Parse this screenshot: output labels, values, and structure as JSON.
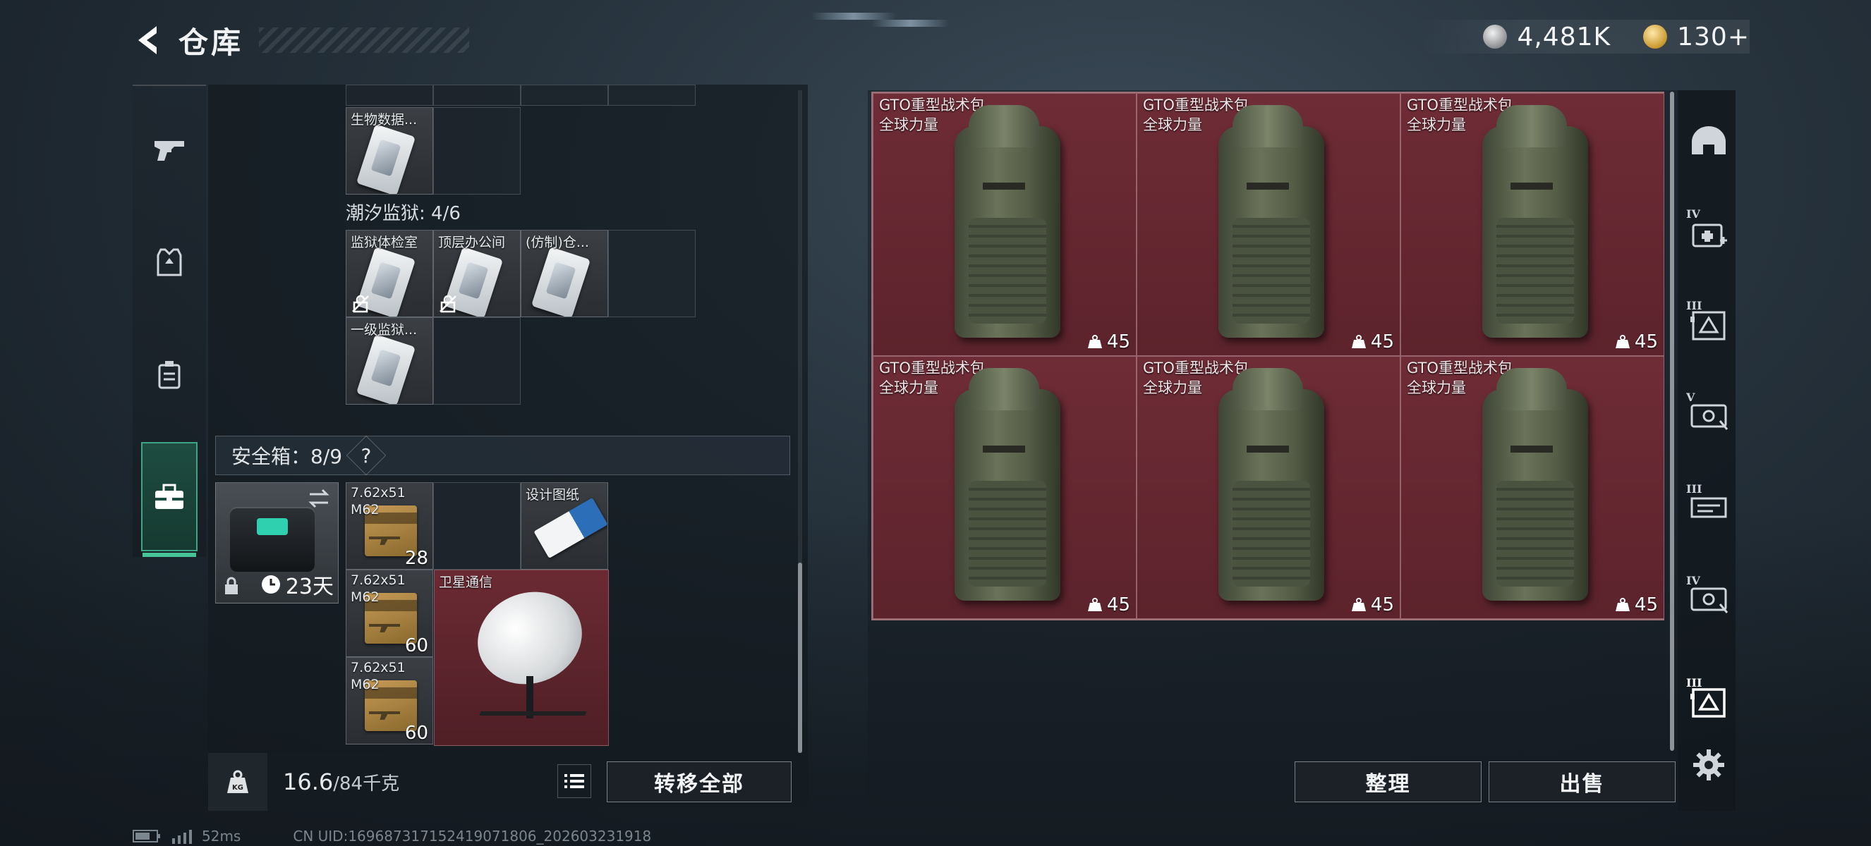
{
  "header": {
    "title": "仓库",
    "back_icon": "back-arrow-icon"
  },
  "currency": [
    {
      "icon": "silver-coin-icon",
      "value": "4,481K"
    },
    {
      "icon": "gold-coin-icon",
      "value": "130+"
    }
  ],
  "left_nav": [
    {
      "icon": "pistol-icon",
      "active": false
    },
    {
      "icon": "armor-vest-icon",
      "active": false
    },
    {
      "icon": "chest-rig-icon",
      "active": false
    },
    {
      "icon": "toolbox-icon",
      "active": true
    }
  ],
  "inventory": {
    "group_top_items": [
      {
        "label": "生物数据..."
      }
    ],
    "group_tidal_prison": {
      "title": "潮汐监狱: 4/6",
      "items": [
        {
          "label": "监狱体检室",
          "unlock_icon": true
        },
        {
          "label": "顶层办公间",
          "unlock_icon": true
        },
        {
          "label": "(仿制)仓..."
        },
        {
          "label": "一级监狱..."
        }
      ]
    },
    "safebox": {
      "title": "安全箱：8/9",
      "help": "?",
      "case_days": "23天",
      "items": [
        {
          "label": "7.62x51 M62",
          "count": "28"
        },
        {
          "label": "设计图纸"
        },
        {
          "label": "7.62x51 M62",
          "count": "60"
        },
        {
          "label": "卫星通信"
        },
        {
          "label": "7.62x51 M62",
          "count": "60"
        }
      ]
    }
  },
  "bottom_bar": {
    "weight_current": "16.6",
    "weight_max": "/84千克",
    "transfer_all": "转移全部"
  },
  "storage": {
    "backpacks": [
      {
        "name": "GTO重型战术包",
        "sub": "全球力量",
        "weight": "45"
      },
      {
        "name": "GTO重型战术包",
        "sub": "全球力量",
        "weight": "45"
      },
      {
        "name": "GTO重型战术包",
        "sub": "全球力量",
        "weight": "45"
      },
      {
        "name": "GTO重型战术包",
        "sub": "全球力量",
        "weight": "45"
      },
      {
        "name": "GTO重型战术包",
        "sub": "全球力量",
        "weight": "45"
      },
      {
        "name": "GTO重型战术包",
        "sub": "全球力量",
        "weight": "45"
      }
    ],
    "sort_button": "整理",
    "sell_button": "出售"
  },
  "right_rail": [
    {
      "icon": "helmet-icon",
      "level": ""
    },
    {
      "icon": "medkit-icon",
      "level": "IV"
    },
    {
      "icon": "container-icon",
      "level": "III"
    },
    {
      "icon": "case-icon",
      "level": "V"
    },
    {
      "icon": "rack-icon",
      "level": "III"
    },
    {
      "icon": "case-icon",
      "level": "IV"
    },
    {
      "icon": "container-icon",
      "level": "III"
    },
    {
      "icon": "gear-icon",
      "level": ""
    }
  ],
  "status": {
    "ping": "52ms",
    "uid": "CN UID:1696873171524190718​06_202603231918"
  },
  "colors": {
    "accent_green": "#46c497",
    "item_red": "#6a2a33",
    "panel_dark": "#161c22"
  }
}
